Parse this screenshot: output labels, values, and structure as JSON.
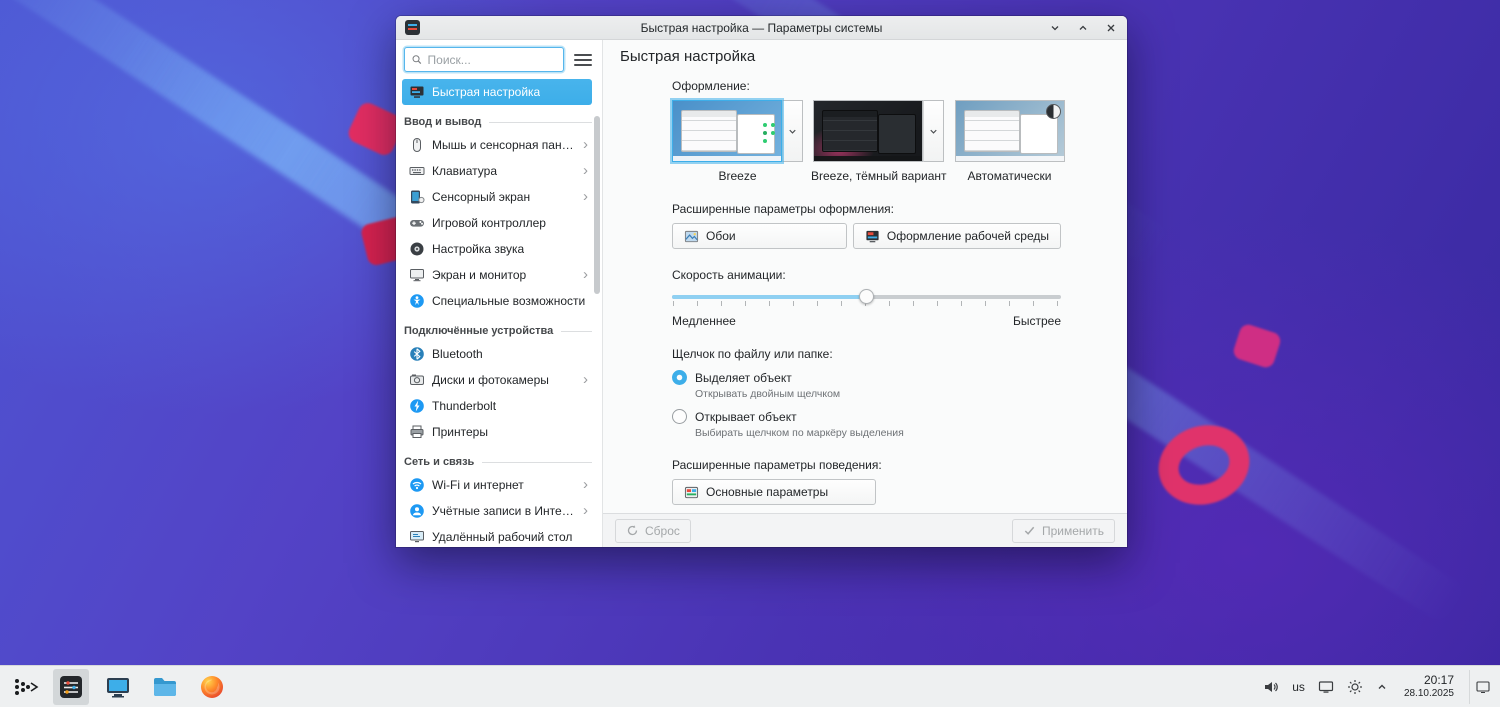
{
  "colors": {
    "accent": "#3daee9",
    "selection_text": "#ffffff",
    "titlebar_bg": "#e9eaeb"
  },
  "icons": {
    "chevron_right": "›"
  },
  "window": {
    "title": "Быстрая настройка — Параметры системы",
    "sidebar": {
      "search_placeholder": "Поиск...",
      "sections": [
        {
          "title": "",
          "items": [
            {
              "label": "Быстрая настройка"
            }
          ]
        },
        {
          "title": "Ввод и вывод",
          "items": [
            {
              "label": "Мышь и сенсорная панель"
            },
            {
              "label": "Клавиатура"
            },
            {
              "label": "Сенсорный экран"
            },
            {
              "label": "Игровой контроллер"
            },
            {
              "label": "Настройка звука"
            },
            {
              "label": "Экран и монитор"
            },
            {
              "label": "Специальные возможности"
            }
          ]
        },
        {
          "title": "Подключённые устройства",
          "items": [
            {
              "label": "Bluetooth"
            },
            {
              "label": "Диски и фотокамеры"
            },
            {
              "label": "Thunderbolt"
            },
            {
              "label": "Принтеры"
            }
          ]
        },
        {
          "title": "Сеть и связь",
          "items": [
            {
              "label": "Wi-Fi и интернет"
            },
            {
              "label": "Учётные записи в Интерне..."
            },
            {
              "label": "Удалённый рабочий стол"
            }
          ]
        }
      ]
    },
    "content": {
      "header": "Быстрая настройка",
      "appearance_label": "Оформление:",
      "themes": [
        {
          "label": "Breeze"
        },
        {
          "label": "Breeze, тёмный вариант"
        },
        {
          "label": "Автоматически"
        }
      ],
      "advanced_appearance_label": "Расширенные параметры оформления:",
      "wallpaper_button": "Обои",
      "desktop_theme_button": "Оформление рабочей среды",
      "animation_label": "Скорость анимации:",
      "slider_slow": "Медленнее",
      "slider_fast": "Быстрее",
      "click_label": "Щелчок по файлу или папке:",
      "radio_select": "Выделяет объект",
      "radio_select_sub": "Открывать двойным щелчком",
      "radio_open": "Открывает объект",
      "radio_open_sub": "Выбирать щелчком по маркёру выделения",
      "advanced_behavior_label": "Расширенные параметры поведения:",
      "behavior_button": "Основные параметры",
      "reset_button": "Сброс",
      "apply_button": "Применить"
    }
  },
  "taskbar": {
    "keyboard_layout": "us",
    "time": "20:17",
    "date": "28.10.2025"
  }
}
